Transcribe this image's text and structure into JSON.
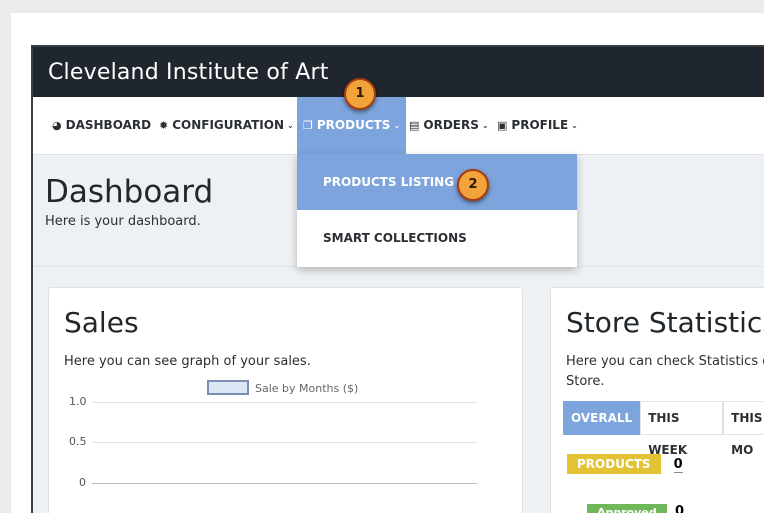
{
  "header": {
    "title": "Cleveland Institute of Art"
  },
  "nav": [
    {
      "label": "DASHBOARD",
      "icon": "dashboard-icon"
    },
    {
      "label": "CONFIGURATION",
      "icon": "gear-icon"
    },
    {
      "label": "PRODUCTS",
      "icon": "box-icon"
    },
    {
      "label": "ORDERS",
      "icon": "list-icon"
    },
    {
      "label": "PROFILE",
      "icon": "id-card-icon"
    }
  ],
  "dropdown": {
    "items": [
      "PRODUCTS LISTING",
      "SMART COLLECTIONS"
    ]
  },
  "callouts": [
    "1",
    "2"
  ],
  "page": {
    "title": "Dashboard",
    "subtitle": "Here is your dashboard."
  },
  "sales": {
    "title": "Sales",
    "subtitle": "Here you can see graph of your sales.",
    "legend": "Sale by Months ($)",
    "yticks": [
      "1.0",
      "0.5",
      "0"
    ]
  },
  "stats": {
    "title": "Store Statistics",
    "subtitle_line1": "Here you can check Statistics o",
    "subtitle_line2": "Store.",
    "tabs": [
      "OVERALL",
      "THIS WEEK",
      "THIS MO"
    ],
    "products_label": "PRODUCTS",
    "products_value": "0",
    "approved_label": "Approved",
    "approved_value": "0"
  },
  "colors": {
    "topbar": "#20262d",
    "accent": "#7da4dc",
    "callout": "#f2a33a"
  },
  "chart_data": {
    "type": "line",
    "title": "",
    "series": [
      {
        "name": "Sale by Months ($)",
        "values": []
      }
    ],
    "ylim": [
      0,
      1.0
    ],
    "yticks": [
      1.0,
      0.5,
      0
    ],
    "grid": true,
    "legend": "top"
  }
}
